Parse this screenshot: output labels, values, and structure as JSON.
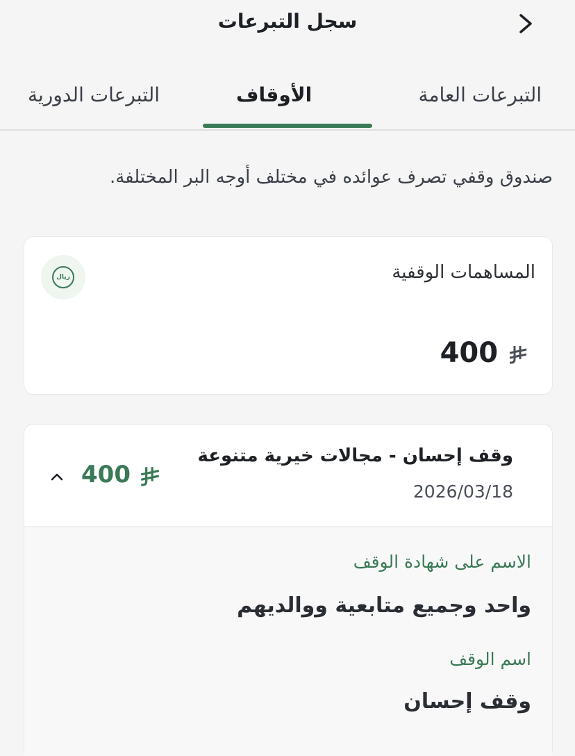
{
  "header": {
    "title": "سجل التبرعات",
    "back_icon": "chevron-right-icon"
  },
  "tabs": [
    {
      "label": "التبرعات العامة",
      "active": false
    },
    {
      "label": "الأوقاف",
      "active": true
    },
    {
      "label": "التبرعات الدورية",
      "active": false
    }
  ],
  "description": "صندوق وقفي تصرف عوائده في مختلف أوجه البر المختلفة.",
  "summary": {
    "label": "المساهمات الوقفية",
    "badge_text": "ريال",
    "amount": "400"
  },
  "donation": {
    "title": "وقف إحسان - مجالات خيرية متنوعة",
    "date": "2026/03/18",
    "amount": "400",
    "expanded": true,
    "fields": [
      {
        "label": "الاسم على شهادة الوقف",
        "value": "واحد وجميع متابعية ووالديهم"
      },
      {
        "label": "اسم الوقف",
        "value": "وقف إحسان"
      }
    ]
  },
  "colors": {
    "accent": "#3a7a56",
    "background": "#f5f5f6"
  }
}
